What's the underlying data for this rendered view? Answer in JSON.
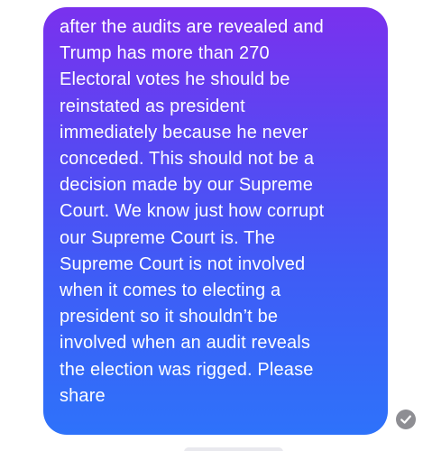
{
  "message": {
    "lines": [
      "after the audits are revealed and",
      "Trump has more than 270",
      "Electoral votes he should be",
      "reinstated as president",
      "immediately because he never",
      "conceded. This should not be a",
      "decision made by our Supreme",
      "Court. We know just how corrupt",
      "our Supreme Court is. The",
      "Supreme Court is not involved",
      "when it comes to electing a",
      "president so it shouldn’t be",
      "involved when an audit reveals",
      "the election was rigged. Please",
      "share"
    ]
  },
  "status": {
    "icon": "checkmark-circle-icon"
  },
  "colors": {
    "bubble_top": "#7a31ee",
    "bubble_bottom": "#2e72fa",
    "text": "#ffffff",
    "receipt": "#8e8e93"
  }
}
